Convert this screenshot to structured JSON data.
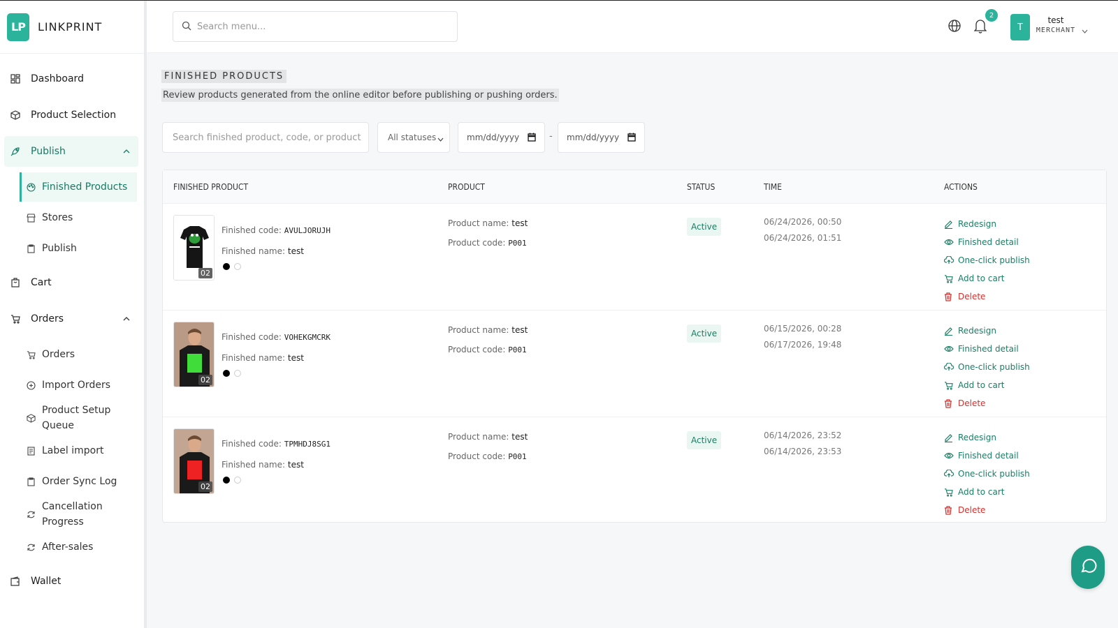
{
  "brand": {
    "logo_text": "LP",
    "name": "LINKPRINT"
  },
  "sidebar": {
    "items": [
      {
        "label": "Dashboard",
        "icon": "dashboard-icon"
      },
      {
        "label": "Product Selection",
        "icon": "box-icon"
      },
      {
        "label": "Publish",
        "icon": "rocket-icon",
        "expanded": true,
        "children": [
          {
            "label": "Finished Products",
            "icon": "palette-icon",
            "active": true
          },
          {
            "label": "Stores",
            "icon": "store-icon"
          },
          {
            "label": "Publish",
            "icon": "clipboard-icon"
          }
        ]
      },
      {
        "label": "Cart",
        "icon": "bag-icon"
      },
      {
        "label": "Orders",
        "icon": "cart-icon",
        "expanded": true,
        "children": [
          {
            "label": "Orders",
            "icon": "cart-icon"
          },
          {
            "label": "Import Orders",
            "icon": "plus-circle-icon"
          },
          {
            "label": "Product Setup Queue",
            "icon": "box-icon"
          },
          {
            "label": "Label import",
            "icon": "label-icon"
          },
          {
            "label": "Order Sync Log",
            "icon": "clipboard-icon"
          },
          {
            "label": "Cancellation Progress",
            "icon": "refresh-icon"
          },
          {
            "label": "After-sales",
            "icon": "refresh-icon"
          }
        ]
      },
      {
        "label": "Wallet",
        "icon": "wallet-icon"
      }
    ]
  },
  "topbar": {
    "search_placeholder": "Search menu...",
    "notification_count": "2",
    "user": {
      "avatar_letter": "T",
      "name": "test",
      "role": "MERCHANT"
    }
  },
  "page": {
    "title": "FINISHED PRODUCTS",
    "description": "Review products generated from the online editor before publishing or pushing orders."
  },
  "filters": {
    "search_placeholder": "Search finished product, code, or product",
    "status_value": "All statuses",
    "date_from": "mm/dd/yyyy",
    "date_sep": "-",
    "date_to": "mm/dd/yyyy"
  },
  "table": {
    "headers": [
      "FINISHED PRODUCT",
      "PRODUCT",
      "STATUS",
      "TIME",
      "ACTIONS"
    ],
    "labels": {
      "finished_code": "Finished code: ",
      "finished_name": "Finished name: ",
      "product_name": "Product name: ",
      "product_code": "Product code: "
    },
    "rows": [
      {
        "finished_code": "AVULJORUJH",
        "finished_name": "test",
        "image_count": "02",
        "product_name": "test",
        "product_code": "P001",
        "status": "Active",
        "time_created": "06/24/2026, 00:50",
        "time_updated": "06/24/2026, 01:51",
        "thumb": "frog-tshirt",
        "swatches": [
          "#000000",
          "#ffffff"
        ]
      },
      {
        "finished_code": "VOHEKGMCRK",
        "finished_name": "test",
        "image_count": "02",
        "product_name": "test",
        "product_code": "P001",
        "status": "Active",
        "time_created": "06/15/2026, 00:28",
        "time_updated": "06/17/2026, 19:48",
        "thumb": "boy-green-print",
        "swatches": [
          "#000000",
          "#ffffff"
        ]
      },
      {
        "finished_code": "TPMHDJ8SG1",
        "finished_name": "test",
        "image_count": "02",
        "product_name": "test",
        "product_code": "P001",
        "status": "Active",
        "time_created": "06/14/2026, 23:52",
        "time_updated": "06/14/2026, 23:53",
        "thumb": "boy-red-print",
        "swatches": [
          "#000000",
          "#ffffff"
        ]
      }
    ],
    "actions": [
      {
        "label": "Redesign",
        "icon": "pencil-icon"
      },
      {
        "label": "Finished detail",
        "icon": "eye-icon"
      },
      {
        "label": "One-click publish",
        "icon": "cloud-upload-icon"
      },
      {
        "label": "Add to cart",
        "icon": "cart-icon"
      },
      {
        "label": "Delete",
        "icon": "trash-icon"
      }
    ]
  },
  "colors": {
    "accent": "#2bb39b",
    "accent_dark": "#1b7d63",
    "danger": "#d0312d"
  }
}
